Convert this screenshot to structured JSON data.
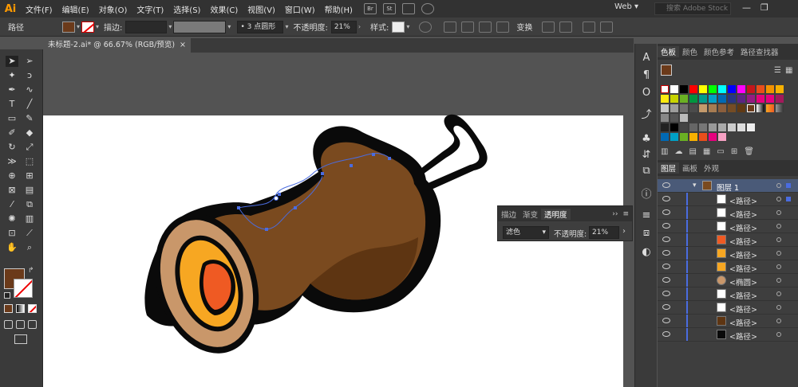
{
  "app": {
    "logo": "Ai",
    "workspace": "Web ▾",
    "search_placeholder": "搜索 Adobe Stock"
  },
  "menu": [
    "文件(F)",
    "编辑(E)",
    "对象(O)",
    "文字(T)",
    "选择(S)",
    "效果(C)",
    "视图(V)",
    "窗口(W)",
    "帮助(H)"
  ],
  "menu_icons": [
    "Br",
    "St"
  ],
  "control_bar": {
    "selection_label": "路径",
    "stroke_label": "描边:",
    "brush_value": "• 3 点圆形",
    "opacity_label": "不透明度:",
    "opacity_value": "21%",
    "style_label": "样式:",
    "transform_label": "变换"
  },
  "document_tab": {
    "title": "未标题-2.ai* @ 66.67% (RGB/预览)",
    "close": "×"
  },
  "color_panel": {
    "tabs": [
      "色板",
      "颜色",
      "颜色参考",
      "路径查找器"
    ]
  },
  "layers_panel": {
    "tabs": [
      "图层",
      "画板",
      "外观"
    ],
    "layer_name": "图层 1",
    "rows": [
      "<路径>",
      "<路径>",
      "<路径>",
      "<路径>",
      "<路径>",
      "<路径>",
      "<椭圆>",
      "<路径>",
      "<路径>",
      "<路径>",
      "<路径>"
    ]
  },
  "transparency_panel": {
    "tabs": [
      "描边",
      "渐变",
      "透明度"
    ],
    "blend_mode": "滤色",
    "opacity_label": "不透明度:",
    "opacity_value": "21%"
  },
  "colors": {
    "fill": "#6b3a1a",
    "gourd_brown": "#7a4a1f",
    "gourd_dark": "#5e3512",
    "cut_tan": "#c9976a",
    "ring_orange": "#f7a722",
    "core_red": "#ef5a23",
    "outline": "#0a0a0a",
    "selection": "#4a6ce0"
  }
}
